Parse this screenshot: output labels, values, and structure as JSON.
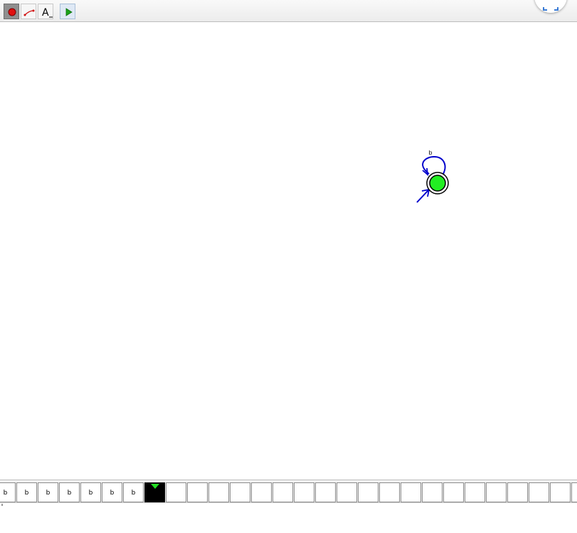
{
  "toolbar": {
    "tools": [
      {
        "id": "state",
        "icon": "red-dot-state-icon",
        "selected": true
      },
      {
        "id": "transition",
        "icon": "transition-arrow-icon",
        "selected": false
      },
      {
        "id": "label",
        "icon": "text-label-icon",
        "glyph": "A",
        "selected": false
      },
      {
        "id": "run",
        "icon": "play-icon",
        "selected": false
      }
    ]
  },
  "automaton": {
    "states": [
      {
        "id": "q0",
        "initial": true,
        "accepting": true,
        "color": "#22ee22"
      }
    ],
    "transitions": [
      {
        "from": "q0",
        "to": "q0",
        "label": "b",
        "color": "#0000cc"
      }
    ]
  },
  "tape": {
    "cells": [
      "b",
      "b",
      "b",
      "b",
      "b",
      "b",
      "b",
      "",
      "",
      "",
      "",
      "",
      "",
      "",
      "",
      "",
      "",
      "",
      "",
      "",
      "",
      "",
      "",
      "",
      "",
      "",
      "",
      ""
    ],
    "head_index": 7,
    "head_color": "#22dd22"
  }
}
